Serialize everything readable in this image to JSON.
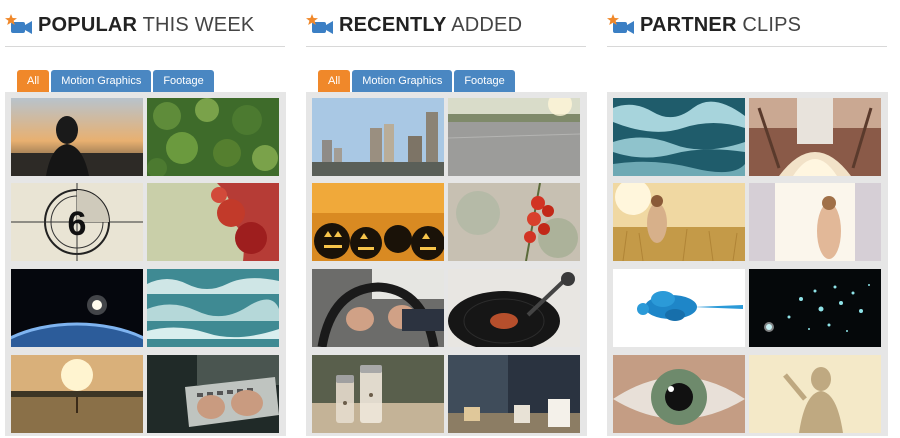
{
  "columns": [
    {
      "heading_strong": "POPULAR",
      "heading_light": "THIS WEEK",
      "tabs": [
        "All",
        "Motion Graphics",
        "Footage"
      ]
    },
    {
      "heading_strong": "RECENTLY",
      "heading_light": "ADDED",
      "tabs": [
        "All",
        "Motion Graphics",
        "Footage"
      ]
    },
    {
      "heading_strong": "PARTNER",
      "heading_light": "CLIPS"
    }
  ],
  "colors": {
    "tab_active": "#f0882a",
    "tab_inactive": "#4a87c2",
    "icon_camera": "#3b7fc4",
    "icon_star": "#f0882a"
  },
  "icons": {
    "heading_icon": "video-camera-star-icon"
  },
  "thumbnails": {
    "popular": [
      "person-sunset",
      "pine-forest-aerial",
      "film-countdown-6",
      "red-ink-in-water",
      "earth-from-space",
      "ocean-waves-aerial",
      "sunset-field",
      "hands-typing-laptop"
    ],
    "recent": [
      "city-skyline",
      "road-driving",
      "jack-o-lanterns",
      "red-berries-bokeh",
      "hands-on-steering-wheel",
      "vinyl-record-player",
      "salt-pepper-shakers",
      "cafe-cups"
    ],
    "partner": [
      "ocean-water-aerial",
      "rocket-launch",
      "woman-in-wheat-field",
      "woman-at-window",
      "blue-ink-splash",
      "particles-dark",
      "eye-closeup",
      "silhouette-light"
    ]
  }
}
